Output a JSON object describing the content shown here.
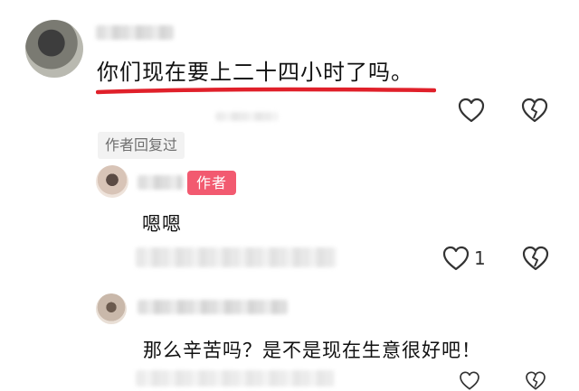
{
  "comments": [
    {
      "text": "你们现在要上二十四小时了吗。",
      "author_replied_label": "作者回复过"
    }
  ],
  "replies": [
    {
      "badge": "作者",
      "text": "嗯嗯",
      "like_count": "1"
    },
    {
      "text": "那么辛苦吗？是不是现在生意很好吧！"
    }
  ],
  "colors": {
    "underline": "#e0202a",
    "badge": "#f25a70"
  },
  "icons": [
    "heart-icon",
    "broken-heart-icon"
  ]
}
